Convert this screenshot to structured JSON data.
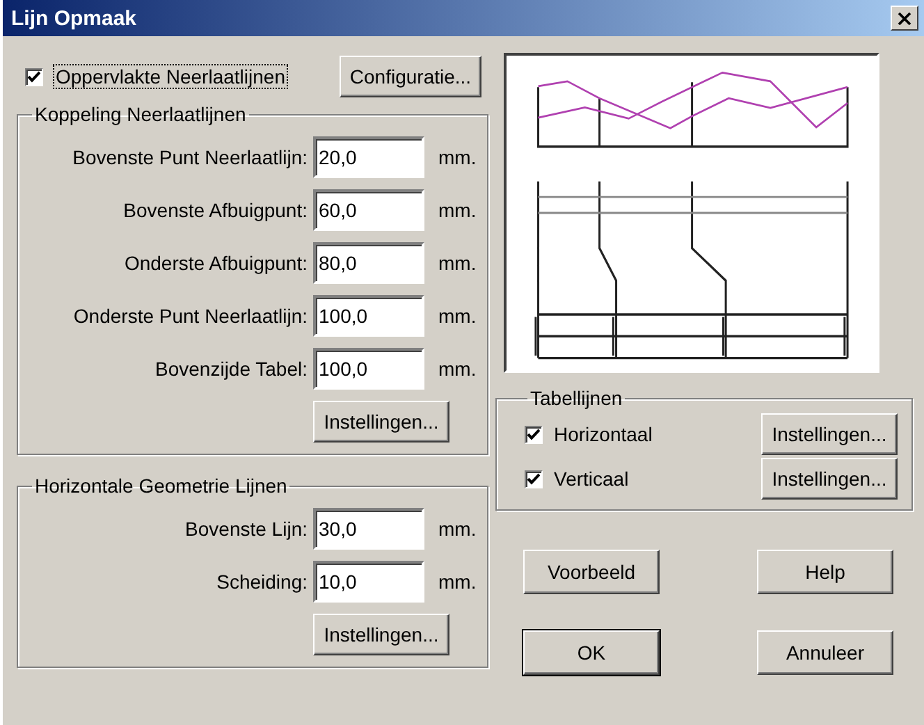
{
  "window": {
    "title": "Lijn Opmaak"
  },
  "surface_option": {
    "label": "Oppervlakte Neerlaatlijnen",
    "checked": true
  },
  "config_button": "Configuratie...",
  "coupling": {
    "title": "Koppeling Neerlaatlijnen",
    "fields": [
      {
        "label": "Bovenste Punt Neerlaatlijn:",
        "value": "20,0",
        "unit": "mm."
      },
      {
        "label": "Bovenste Afbuigpunt:",
        "value": "60,0",
        "unit": "mm."
      },
      {
        "label": "Onderste Afbuigpunt:",
        "value": "80,0",
        "unit": "mm."
      },
      {
        "label": "Onderste Punt Neerlaatlijn:",
        "value": "100,0",
        "unit": "mm."
      },
      {
        "label": "Bovenzijde Tabel:",
        "value": "100,0",
        "unit": "mm."
      }
    ],
    "button": "Instellingen..."
  },
  "geometry": {
    "title": "Horizontale Geometrie Lijnen",
    "fields": [
      {
        "label": "Bovenste Lijn:",
        "value": "30,0",
        "unit": "mm."
      },
      {
        "label": "Scheiding:",
        "value": "10,0",
        "unit": "mm."
      }
    ],
    "button": "Instellingen..."
  },
  "table_lines": {
    "title": "Tabellijnen",
    "options": [
      {
        "label": "Horizontaal",
        "checked": true,
        "button": "Instellingen..."
      },
      {
        "label": "Verticaal",
        "checked": true,
        "button": "Instellingen..."
      }
    ]
  },
  "buttons": [
    {
      "label": "Voorbeeld",
      "default": false
    },
    {
      "label": "Help",
      "default": false
    },
    {
      "label": "OK",
      "default": true
    },
    {
      "label": "Annuleer",
      "default": false
    }
  ]
}
